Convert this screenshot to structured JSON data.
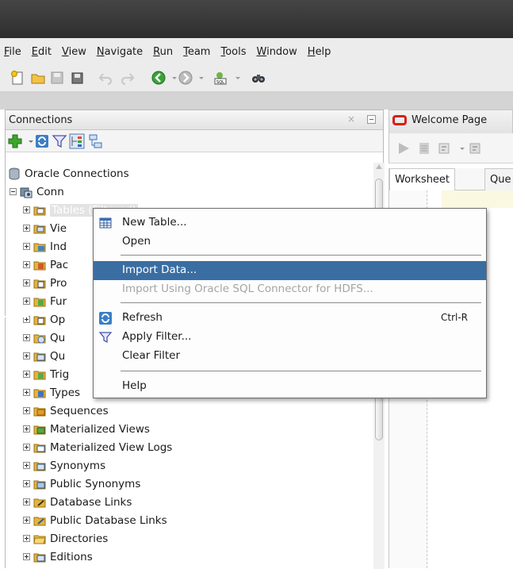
{
  "menubar": [
    "File",
    "Edit",
    "View",
    "Navigate",
    "Run",
    "Team",
    "Tools",
    "Window",
    "Help"
  ],
  "connections_panel": {
    "title": "Connections",
    "close_glyph": "×"
  },
  "tree": {
    "root": "Oracle Connections",
    "connection": "Conn",
    "items": [
      {
        "label": "Tables (Filtered)",
        "icon": "tables-icon"
      },
      {
        "label": "Vie",
        "icon": "views-icon"
      },
      {
        "label": "Ind",
        "icon": "indexes-icon"
      },
      {
        "label": "Pac",
        "icon": "packages-icon"
      },
      {
        "label": "Pro",
        "icon": "procedures-icon"
      },
      {
        "label": "Fur",
        "icon": "functions-icon"
      },
      {
        "label": "Op",
        "icon": "operators-icon"
      },
      {
        "label": "Qu",
        "icon": "queues-icon"
      },
      {
        "label": "Qu",
        "icon": "queue-tables-icon"
      },
      {
        "label": "Trig",
        "icon": "triggers-icon"
      },
      {
        "label": "Types",
        "icon": "types-icon"
      },
      {
        "label": "Sequences",
        "icon": "sequences-icon"
      },
      {
        "label": "Materialized Views",
        "icon": "materialized-views-icon"
      },
      {
        "label": "Materialized View Logs",
        "icon": "materialized-view-logs-icon"
      },
      {
        "label": "Synonyms",
        "icon": "synonyms-icon"
      },
      {
        "label": "Public Synonyms",
        "icon": "public-synonyms-icon"
      },
      {
        "label": "Database Links",
        "icon": "database-links-icon"
      },
      {
        "label": "Public Database Links",
        "icon": "public-database-links-icon"
      },
      {
        "label": "Directories",
        "icon": "directories-icon"
      },
      {
        "label": "Editions",
        "icon": "editions-icon"
      }
    ]
  },
  "editor": {
    "tab_label": "Welcome Page",
    "ws_tab_1": "Worksheet",
    "ws_tab_2": "Que"
  },
  "context_menu": {
    "new_table": "New Table...",
    "open": "Open",
    "import_data": "Import Data...",
    "import_hdfs": "Import Using Oracle SQL Connector for HDFS...",
    "refresh": "Refresh",
    "refresh_shortcut": "Ctrl-R",
    "apply_filter": "Apply Filter...",
    "clear_filter": "Clear Filter",
    "help": "Help"
  },
  "colors": {
    "selection": "#3a6ea3",
    "oracle_red": "#d7201a",
    "titlebar": "#3a3a3a"
  }
}
